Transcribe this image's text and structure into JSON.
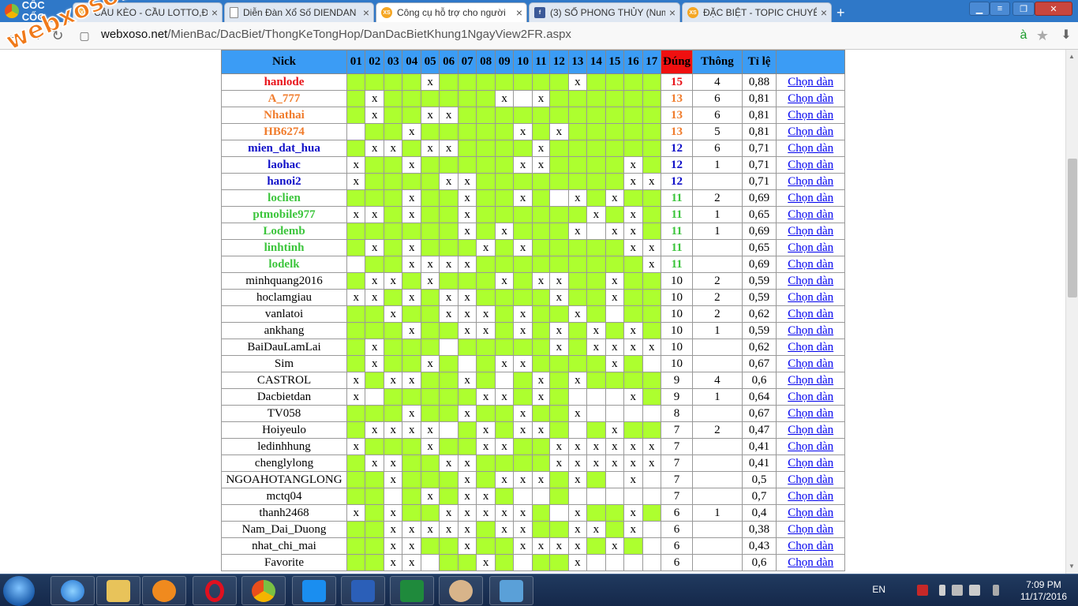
{
  "browser": {
    "logo": "CỐC CỐC",
    "tabs": [
      {
        "title": "CẦU KÈO - CẦU LOTTO,ĐẶ",
        "icon": "xs-icon",
        "label": "XS",
        "active": false
      },
      {
        "title": "Diễn Đàn Xổ Số DIENDAN",
        "icon": "doc-icon",
        "label": "",
        "active": false
      },
      {
        "title": "Công cụ hỗ trợ cho người",
        "icon": "xs-icon",
        "label": "XS",
        "active": true
      },
      {
        "title": "(3) SỐ PHONG THỦY (Num",
        "icon": "fb-icon",
        "label": "f",
        "active": false
      },
      {
        "title": "ĐẶC BIỆT - TOPIC CHUYÊN",
        "icon": "xs-icon",
        "label": "XS",
        "active": false
      }
    ],
    "url_domain": "webxoso.net",
    "url_path": "/MienBac/DacBiet/ThongKeTongHop/DanDacBietKhung1NgayView2FR.aspx"
  },
  "watermark": "webxoso.net",
  "table": {
    "headers": [
      "Nick",
      "01",
      "02",
      "03",
      "04",
      "05",
      "06",
      "07",
      "08",
      "09",
      "10",
      "11",
      "12",
      "13",
      "14",
      "15",
      "16",
      "17",
      "Đúng",
      "Thông",
      "Tỉ lệ",
      ""
    ],
    "link_label": "Chọn dàn",
    "rows": [
      {
        "nick": "hanlode",
        "style": "red",
        "cells": "g g g g x g g g g g g g x g g g g",
        "dung": "15",
        "thong": "4",
        "tile": "0,88"
      },
      {
        "nick": "A_777",
        "style": "orange",
        "cells": "g x g g g g g g x w x g g g g g g",
        "dung": "13",
        "thong": "6",
        "tile": "0,81"
      },
      {
        "nick": "Nhathai",
        "style": "orange",
        "cells": "g x g g x x g g g g g g g g g g g",
        "dung": "13",
        "thong": "6",
        "tile": "0,81"
      },
      {
        "nick": "HB6274",
        "style": "orange",
        "cells": "w g g x g g g g g x g x g g g g g",
        "dung": "13",
        "thong": "5",
        "tile": "0,81"
      },
      {
        "nick": "mien_dat_hua",
        "style": "blue",
        "cells": "g x x g x x g g g g x g g g g g g",
        "dung": "12",
        "thong": "6",
        "tile": "0,71"
      },
      {
        "nick": "laohac",
        "style": "blue",
        "cells": "x g g x g g g g g x x g g g g x g",
        "dung": "12",
        "thong": "1",
        "tile": "0,71"
      },
      {
        "nick": "hanoi2",
        "style": "blue",
        "cells": "x g g g g x x g g g g g g g g x x",
        "dung": "12",
        "thong": "",
        "tile": "0,71"
      },
      {
        "nick": "loclien",
        "style": "green",
        "cells": "g g g x g g x g g x g w x g x g g",
        "dung": "11",
        "thong": "2",
        "tile": "0,69"
      },
      {
        "nick": "ptmobile977",
        "style": "green",
        "cells": "x x g x g g x g g g g g g x g x g",
        "dung": "11",
        "thong": "1",
        "tile": "0,65"
      },
      {
        "nick": "Lodemb",
        "style": "green",
        "cells": "g g g g g g x g x g g g x w x x g",
        "dung": "11",
        "thong": "1",
        "tile": "0,69"
      },
      {
        "nick": "linhtinh",
        "style": "green",
        "cells": "g x g x g g g x g x g g g g g x x",
        "dung": "11",
        "thong": "",
        "tile": "0,65"
      },
      {
        "nick": "lodelk",
        "style": "green",
        "cells": "w g g x x x x g g g g g g g g g x",
        "dung": "11",
        "thong": "",
        "tile": "0,69"
      },
      {
        "nick": "minhquang2016",
        "style": "",
        "cells": "g x x g x g g g x g x x g g x g g",
        "dung": "10",
        "thong": "2",
        "tile": "0,59"
      },
      {
        "nick": "hoclamgiau",
        "style": "",
        "cells": "x x g x g x x g g g g x g g x g g",
        "dung": "10",
        "thong": "2",
        "tile": "0,59"
      },
      {
        "nick": "vanlatoi",
        "style": "",
        "cells": "g g x g g x x x g x g g x g w g g",
        "dung": "10",
        "thong": "2",
        "tile": "0,62"
      },
      {
        "nick": "ankhang",
        "style": "",
        "cells": "g g g x g g x x g x g x g x g x g",
        "dung": "10",
        "thong": "1",
        "tile": "0,59"
      },
      {
        "nick": "BaiDauLamLai",
        "style": "",
        "cells": "g x g g g w g g g g g x g x x x x",
        "dung": "10",
        "thong": "",
        "tile": "0,62"
      },
      {
        "nick": "Sim",
        "style": "",
        "cells": "g x g g x g w g x x g g g g x g w",
        "dung": "10",
        "thong": "",
        "tile": "0,67"
      },
      {
        "nick": "CASTROL",
        "style": "",
        "cells": "x g x x g g x g w g x g x g g g g",
        "dung": "9",
        "thong": "4",
        "tile": "0,6"
      },
      {
        "nick": "Dacbietdan",
        "style": "",
        "cells": "x w g g g g g x x g x g w w w x g",
        "dung": "9",
        "thong": "1",
        "tile": "0,64"
      },
      {
        "nick": "TV058",
        "style": "",
        "cells": "g g g x g g x g g x g g x w w w w",
        "dung": "8",
        "thong": "",
        "tile": "0,67"
      },
      {
        "nick": "Hoiyeulo",
        "style": "",
        "cells": "g x x x x w g x g x x g w g x g g",
        "dung": "7",
        "thong": "2",
        "tile": "0,47"
      },
      {
        "nick": "ledinhhung",
        "style": "",
        "cells": "x g g g x g g x x g g x x x x x x",
        "dung": "7",
        "thong": "",
        "tile": "0,41"
      },
      {
        "nick": "chenglylong",
        "style": "",
        "cells": "g x x g g x x g g g g x x x x x x",
        "dung": "7",
        "thong": "",
        "tile": "0,41"
      },
      {
        "nick": "NGOAHOTANGLONG",
        "style": "",
        "cells": "g g x g g g x g x x x g x g w x w",
        "dung": "7",
        "thong": "",
        "tile": "0,5"
      },
      {
        "nick": "mctq04",
        "style": "",
        "cells": "g g w g x g x x g w w g w w w w w",
        "dung": "7",
        "thong": "",
        "tile": "0,7"
      },
      {
        "nick": "thanh2468",
        "style": "",
        "cells": "x g x g g x x x x x g w x g g x g",
        "dung": "6",
        "thong": "1",
        "tile": "0,4"
      },
      {
        "nick": "Nam_Dai_Duong",
        "style": "",
        "cells": "g g x x x x x g x x g g x x g x w",
        "dung": "6",
        "thong": "",
        "tile": "0,38"
      },
      {
        "nick": "nhat_chi_mai",
        "style": "",
        "cells": "g g x x g g x g g x x x x g x g w",
        "dung": "6",
        "thong": "",
        "tile": "0,43"
      },
      {
        "nick": "Favorite",
        "style": "",
        "cells": "g g x x w g g x g w g g x w w w w",
        "dung": "6",
        "thong": "",
        "tile": "0,6"
      }
    ]
  },
  "taskbar": {
    "lang": "EN",
    "time": "7:09 PM",
    "date": "11/17/2016"
  }
}
